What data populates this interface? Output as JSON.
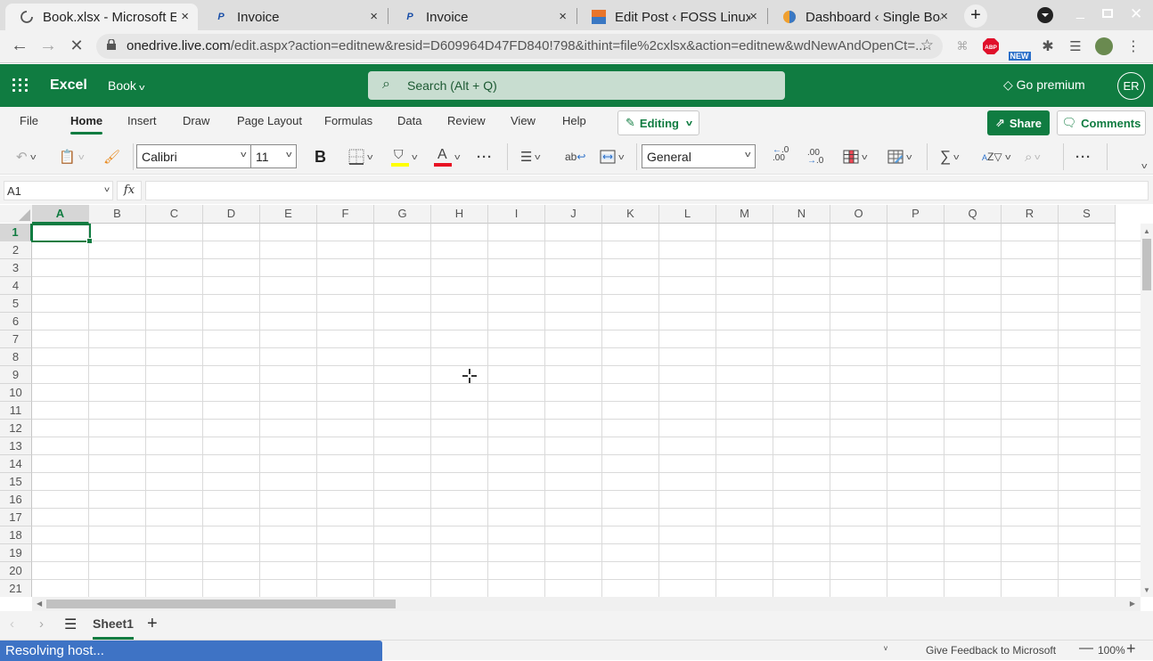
{
  "browser": {
    "tabs": [
      {
        "title": "Book.xlsx - Microsoft Excel",
        "favicon": "loading-spinner-icon",
        "active": true
      },
      {
        "title": "Invoice",
        "favicon": "paypal-icon",
        "active": false
      },
      {
        "title": "Invoice",
        "favicon": "paypal-icon",
        "active": false
      },
      {
        "title": "Edit Post ‹ FOSS Linux",
        "favicon": "fosslinux-icon",
        "active": false
      },
      {
        "title": "Dashboard ‹ Single Board",
        "favicon": "wordpress-icon",
        "active": false
      }
    ],
    "new_tab_label": "+",
    "url_host": "onedrive.live.com",
    "url_path": "/edit.aspx?action=editnew&resid=D609964D47FD840!798&ithint=file%2cxlsx&action=editnew&wdNewAndOpenCt=...",
    "extensions": {
      "abp_label": "ABP",
      "new_badge": "NEW"
    }
  },
  "excel": {
    "app_name": "Excel",
    "book_name": "Book",
    "search_placeholder": "Search (Alt + Q)",
    "go_premium": "Go premium",
    "avatar_initials": "ER",
    "ribbon_tabs": [
      "File",
      "Home",
      "Insert",
      "Draw",
      "Page Layout",
      "Formulas",
      "Data",
      "Review",
      "View",
      "Help"
    ],
    "active_tab": "Home",
    "editing_label": "Editing",
    "share_label": "Share",
    "comments_label": "Comments",
    "toolbar": {
      "font_name": "Calibri",
      "font_size": "11",
      "bold_label": "B",
      "font_color_label": "A",
      "number_format": "General",
      "highlight_color": "#ffff00",
      "font_color": "#e81123",
      "more_label": "···"
    },
    "formula_bar": {
      "name_box": "A1",
      "fx_label": "fx",
      "formula": ""
    },
    "columns": [
      "A",
      "B",
      "C",
      "D",
      "E",
      "F",
      "G",
      "H",
      "I",
      "J",
      "K",
      "L",
      "M",
      "N",
      "O",
      "P",
      "Q",
      "R",
      "S"
    ],
    "rows": [
      "1",
      "2",
      "3",
      "4",
      "5",
      "6",
      "7",
      "8",
      "9",
      "10",
      "11",
      "12",
      "13",
      "14",
      "15",
      "16",
      "17",
      "18",
      "19",
      "20",
      "21"
    ],
    "selected_cell": "A1",
    "sheets": [
      "Sheet1"
    ],
    "active_sheet": "Sheet1",
    "status": {
      "loading_text": "Resolving host...",
      "feedback": "Give Feedback to Microsoft",
      "zoom": "100%"
    },
    "brand_color": "#107c41"
  }
}
